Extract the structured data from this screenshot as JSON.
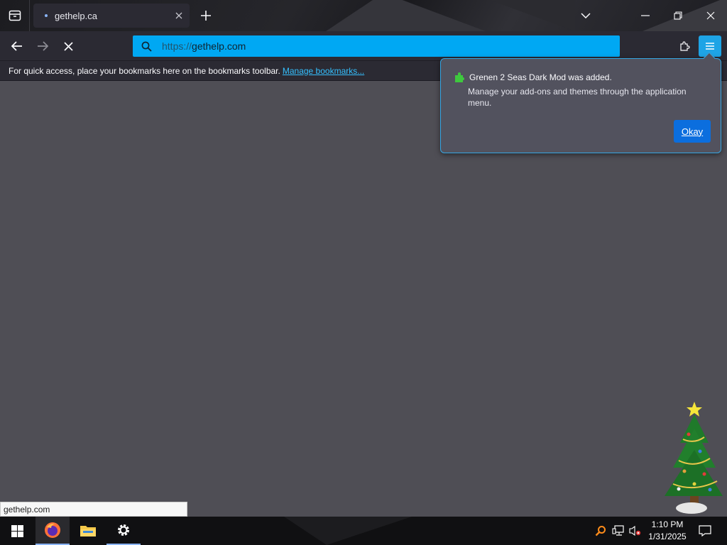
{
  "browser": {
    "tab": {
      "title": "gethelp.ca"
    },
    "url": {
      "scheme": "https://",
      "host": "gethelp.com"
    },
    "bookmarks_bar": {
      "message": "For quick access, place your bookmarks here on the bookmarks toolbar.",
      "manage_link": "Manage bookmarks..."
    }
  },
  "popup": {
    "title": "Grenen 2 Seas Dark Mod was added.",
    "description": "Manage your add-ons and themes through the application menu.",
    "okay_label": "Okay"
  },
  "status_text": "gethelp.com",
  "taskbar": {
    "apps": [
      "start-icon",
      "firefox-icon",
      "file-explorer-icon",
      "settings-icon"
    ],
    "clock": {
      "time": "1:10 PM",
      "date": "1/31/2025"
    }
  },
  "colors": {
    "accent": "#00a8f3",
    "toolbar": "#2b2a33",
    "content": "#4f4e55",
    "okay_button": "#0b6ede"
  }
}
